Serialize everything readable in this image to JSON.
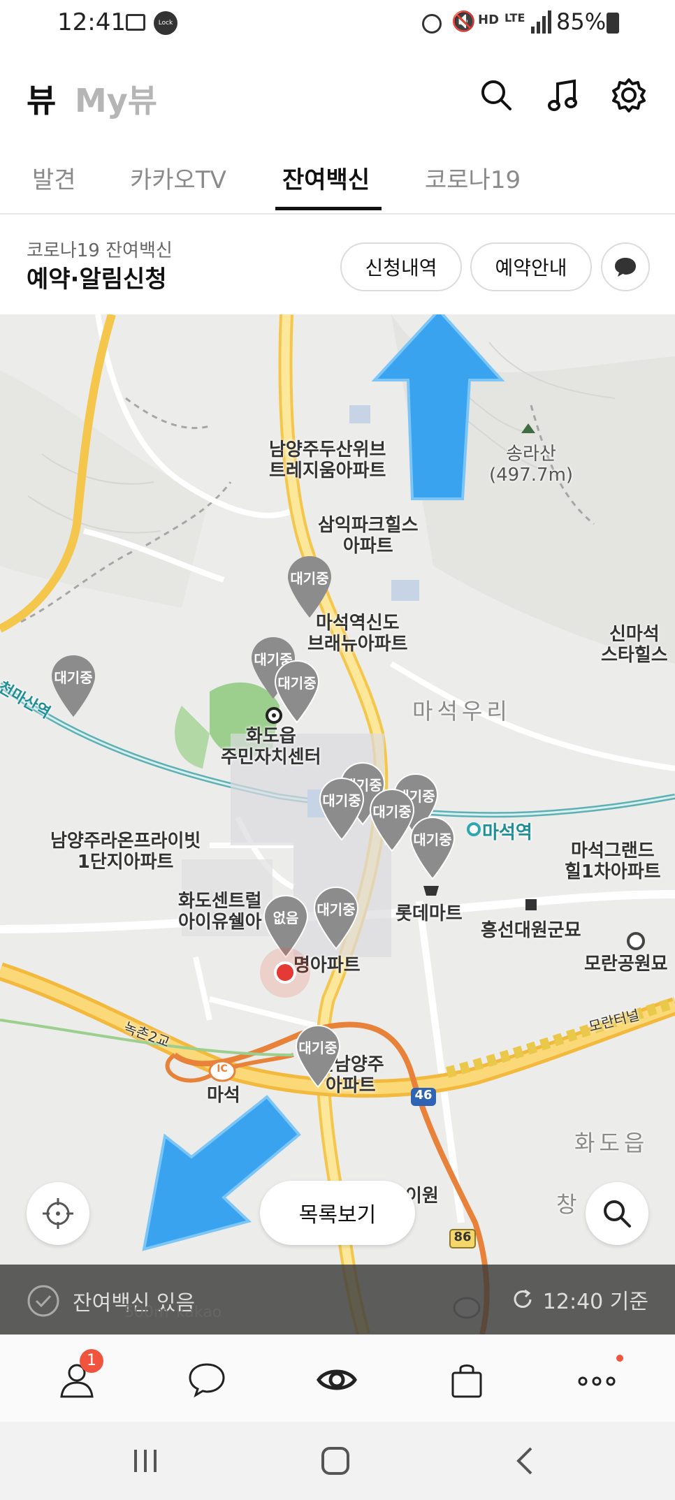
{
  "status_bar": {
    "time": "12:41",
    "lock_badge": "Lock",
    "battery": "85%",
    "network": "LTE"
  },
  "header": {
    "title_view": "뷰",
    "title_myview": "My뷰"
  },
  "tabs": [
    {
      "label": "발견",
      "active": false
    },
    {
      "label": "카카오TV",
      "active": false
    },
    {
      "label": "잔여백신",
      "active": true
    },
    {
      "label": "코로나19",
      "active": false
    }
  ],
  "info": {
    "subtitle": "코로나19 잔여백신",
    "headline": "예약·알림신청",
    "btn_history": "신청내역",
    "btn_guide": "예약안내"
  },
  "map": {
    "labels": {
      "l1": "남양주두산위브\n트레지움아파트",
      "l2": "송라산\n(497.7m)",
      "l3": "삼익파크힐스\n아파트",
      "l4": "마석역신도\n브래뉴아파트",
      "l5": "신마석\n스타힐스",
      "l6": "마석우리",
      "l7": "화도읍\n주민자치센터",
      "l8": "남양주라온프라이빗\n1단지아파트",
      "l9": "마석그랜드\n힐1차아파트",
      "l10": "마석역",
      "l11": "화도센트럴\n아이유쉘아",
      "l12": "롯데마트",
      "l13": "흥선대원군묘",
      "l14": "모란공원묘",
      "l15": "명아파트",
      "l16": "녹촌2교",
      "l17": "마석",
      "l18": "신남양주\n아파트",
      "l19": "화도읍",
      "l20": "모란터널",
      "l21": "천마산역",
      "l22": "이원",
      "l23": "창",
      "road46": "46",
      "road86": "86",
      "ic": "IC"
    },
    "pins": [
      {
        "text": "대기중"
      },
      {
        "text": "대기중"
      },
      {
        "text": "대기중"
      },
      {
        "text": "대기중"
      },
      {
        "text": "대기중"
      },
      {
        "text": "대기중"
      },
      {
        "text": "대기중"
      },
      {
        "text": "대기중"
      },
      {
        "text": "없음"
      },
      {
        "text": "대기중"
      }
    ],
    "list_button": "목록보기",
    "legend": "잔여백신 있음",
    "updated": "12:40 기준",
    "scale": "500m",
    "brand": "kakao"
  },
  "bottom_nav": {
    "badge_count": "1"
  },
  "colors": {
    "accent": "#f0543e",
    "pin": "#8c8c8c",
    "arrow": "#3aa3ef"
  }
}
